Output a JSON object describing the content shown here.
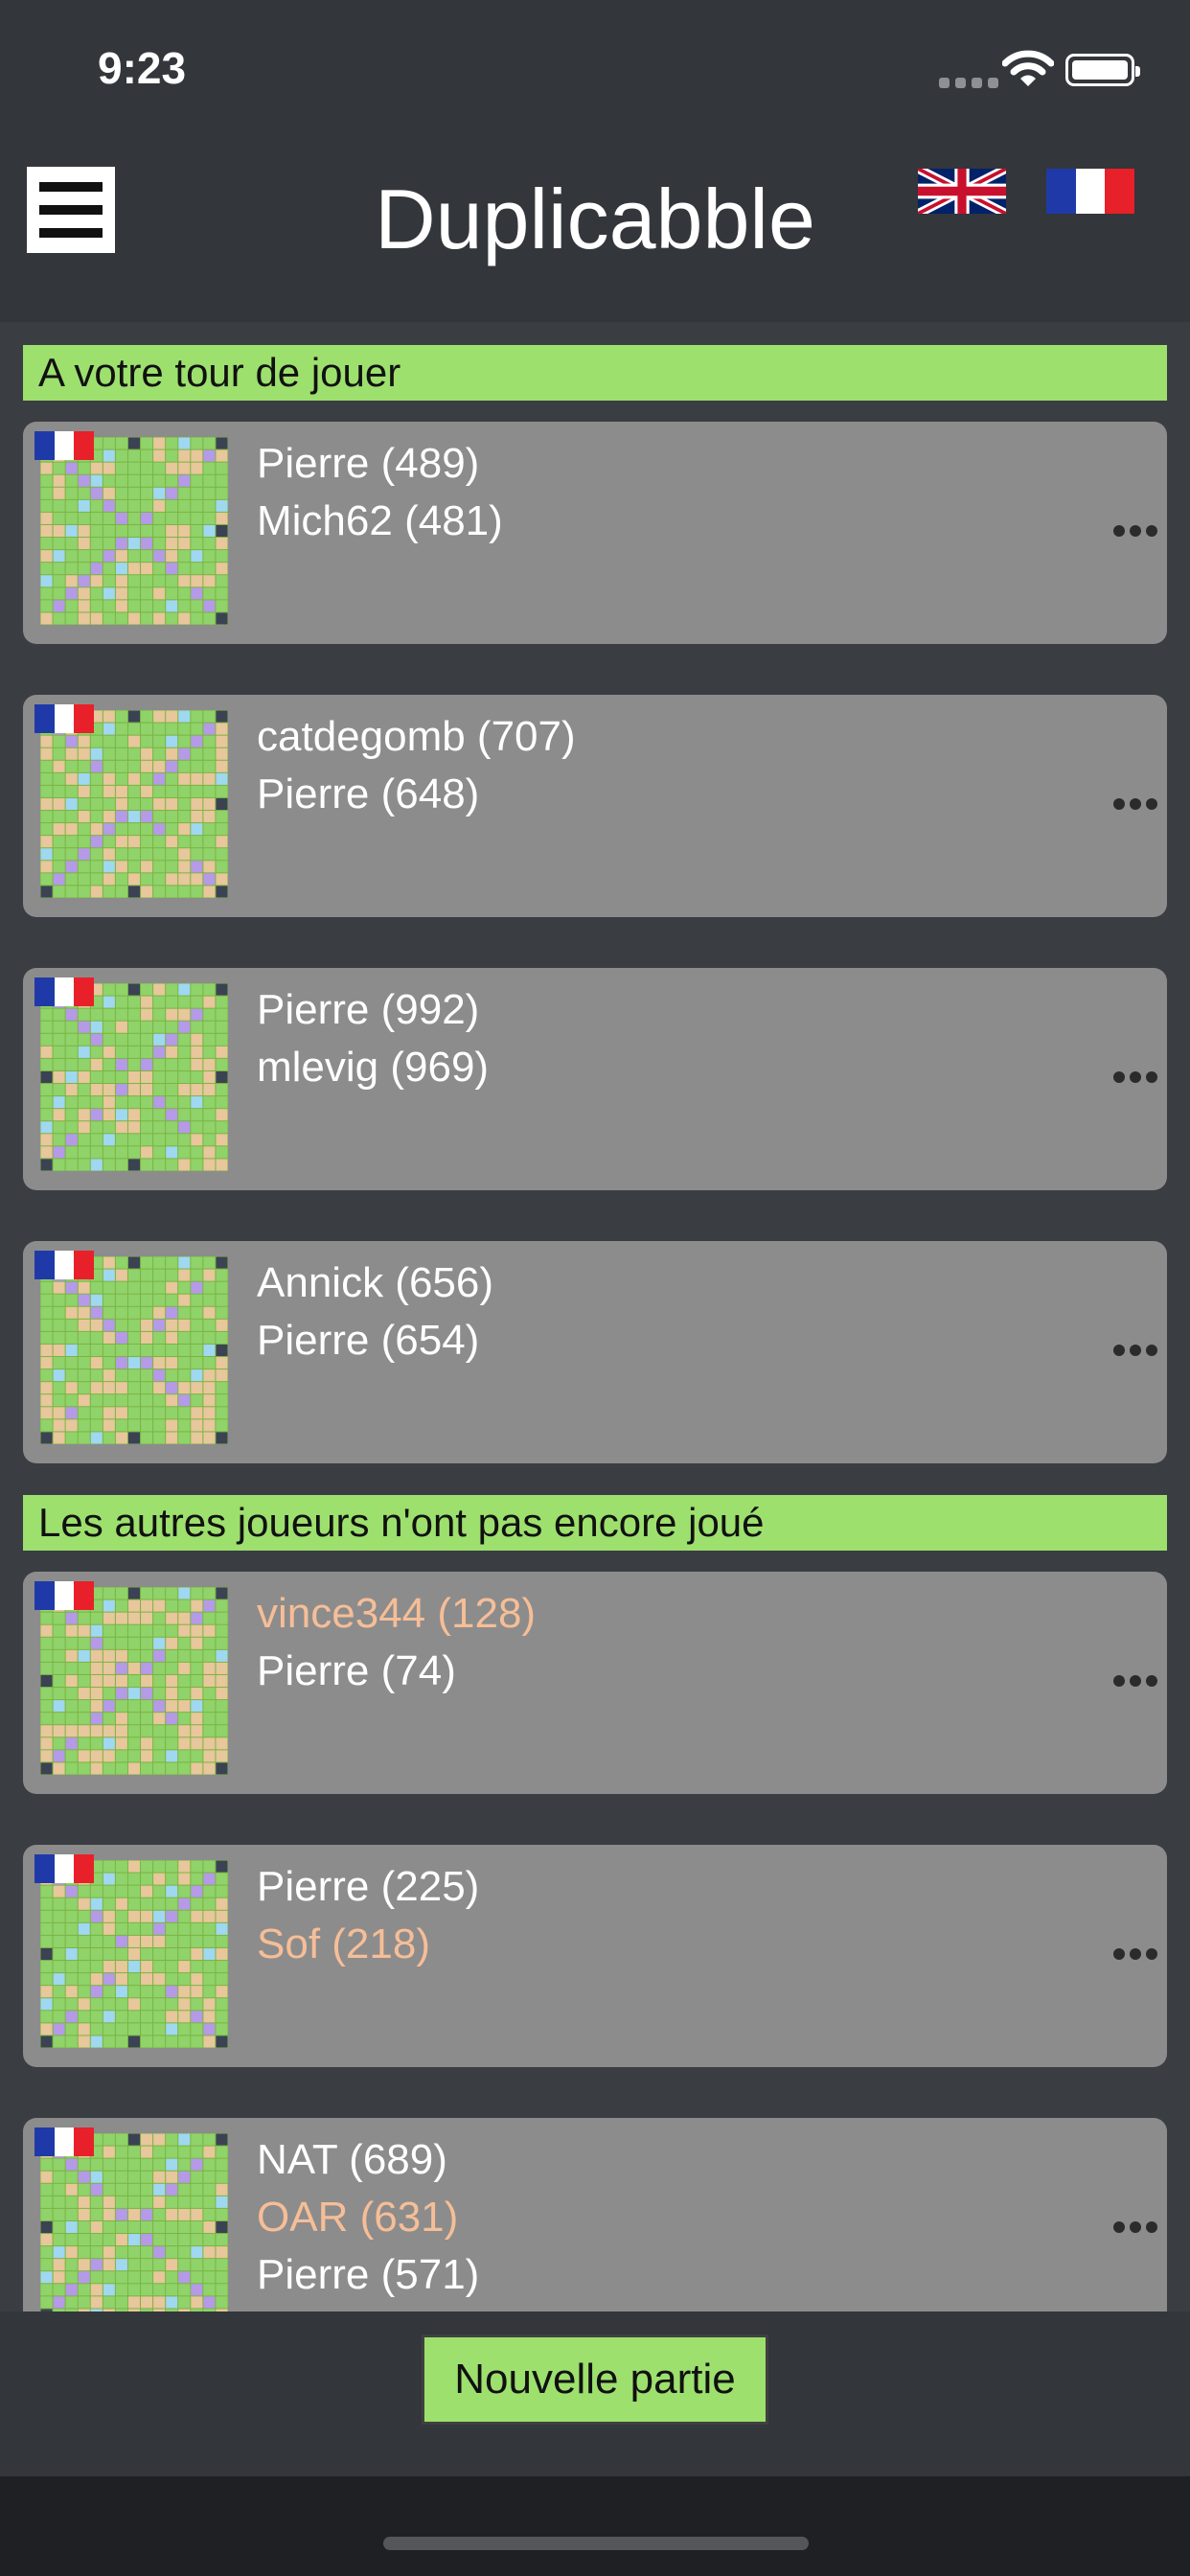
{
  "status_bar": {
    "time": "9:23"
  },
  "header": {
    "title": "Duplicabble",
    "menu_icon": "hamburger-menu-icon",
    "languages": [
      "English",
      "Français"
    ]
  },
  "colors": {
    "section_green": "#9de06e",
    "card_gray": "#8c8c8c",
    "waiting_player": "#f6be97",
    "background": "#33363b"
  },
  "sections": [
    {
      "title": "A votre tour de jouer",
      "games": [
        {
          "players": [
            {
              "text": "Pierre (489)",
              "waiting": false
            },
            {
              "text": "Mich62 (481)",
              "waiting": false
            }
          ]
        },
        {
          "players": [
            {
              "text": "catdegomb (707)",
              "waiting": false
            },
            {
              "text": "Pierre (648)",
              "waiting": false
            }
          ]
        },
        {
          "players": [
            {
              "text": "Pierre (992)",
              "waiting": false
            },
            {
              "text": "mlevig (969)",
              "waiting": false
            }
          ]
        },
        {
          "players": [
            {
              "text": "Annick (656)",
              "waiting": false
            },
            {
              "text": "Pierre (654)",
              "waiting": false
            }
          ]
        }
      ]
    },
    {
      "title": "Les autres joueurs n'ont pas encore joué",
      "games": [
        {
          "players": [
            {
              "text": "vince344 (128)",
              "waiting": true
            },
            {
              "text": "Pierre (74)",
              "waiting": false
            }
          ]
        },
        {
          "players": [
            {
              "text": "Pierre (225)",
              "waiting": false
            },
            {
              "text": "Sof (218)",
              "waiting": true
            }
          ]
        },
        {
          "players": [
            {
              "text": "NAT (689)",
              "waiting": false
            },
            {
              "text": "OAR (631)",
              "waiting": true
            },
            {
              "text": "Pierre (571)",
              "waiting": false
            }
          ]
        }
      ]
    }
  ],
  "footer": {
    "new_game_label": "Nouvelle partie"
  }
}
